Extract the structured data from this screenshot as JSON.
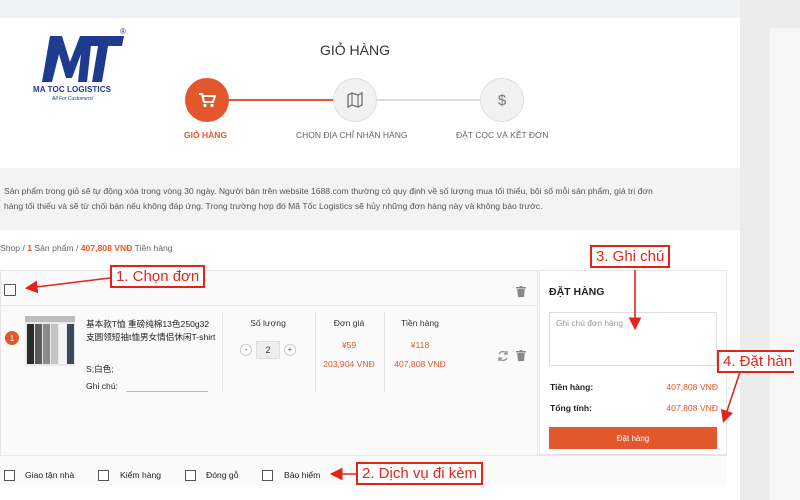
{
  "brand": {
    "name": "MA TOC LOGISTICS",
    "tagline": "All For Customers!",
    "logo_letters": "MT",
    "registered": "®"
  },
  "header": {
    "title": "GIỎ HÀNG"
  },
  "steps": [
    {
      "label": "GIỎ HÀNG",
      "icon": "cart-icon",
      "active": true
    },
    {
      "label": "CHỌN ĐỊA CHỈ NHẬN HÀNG",
      "icon": "map-icon",
      "active": false
    },
    {
      "label": "ĐẶT CỌC VÀ KẾT ĐƠN",
      "icon": "dollar-icon",
      "active": false
    }
  ],
  "notice": {
    "line1": "Sản phẩm trong giỏ sẽ tự động xóa trong vòng 30 ngày. Người bán trên website 1688.com thường có quy định về số lượng mua tối thiểu, bội số mỗi sản phẩm, giá trị đơn",
    "line2": "hàng tối thiểu và sẽ từ chối bán nếu không đáp ứng. Trong trường hợp đó Mã Tốc Logistics sẽ hủy những đơn hàng này và không báo trước."
  },
  "breadcrumb": {
    "shop": "Shop",
    "sep1": " / ",
    "count": "1",
    "products": " Sản phẩm",
    "sep2": " / ",
    "amount": "407,808 VNĐ",
    "amount_label": " Tiền hàng"
  },
  "product": {
    "index": "1",
    "name": "基本款T恤 重磅纯棉13色250g32支圆领短袖t恤男女情侣休闲T-shirt",
    "attributes": "S;白色;",
    "note_label": "Ghi chú:",
    "qty_label": "Số lượng",
    "qty": "2",
    "qty_minus": "-",
    "qty_plus": "+",
    "unit_price_label": "Đơn giá",
    "unit_price_cny": "¥59",
    "unit_price_vnd": "203,904 VNĐ",
    "subtotal_label": "Tiền hàng",
    "subtotal_cny": "¥118",
    "subtotal_vnd": "407,808 VNĐ"
  },
  "order": {
    "title": "ĐẶT HÀNG",
    "note_placeholder": "Ghi chú đơn hàng",
    "goods_label": "Tiền hàng:",
    "goods_value": "407,808 VNĐ",
    "total_label": "Tổng tính:",
    "total_value": "407,808 VNĐ",
    "button_label": "Đặt hàng"
  },
  "services": [
    {
      "label": "Giao tận nhà"
    },
    {
      "label": "Kiểm hàng"
    },
    {
      "label": "Đóng gỗ"
    },
    {
      "label": "Bảo hiểm"
    }
  ],
  "annotations": {
    "select": "1. Chọn đơn",
    "services": "2. Dịch vụ đi kèm",
    "note": "3. Ghi chú",
    "order": "4. Đặt hàn"
  },
  "colors": {
    "accent": "#e2572b",
    "brand_blue": "#1e3b8f",
    "annotation_red": "#e0261b"
  }
}
